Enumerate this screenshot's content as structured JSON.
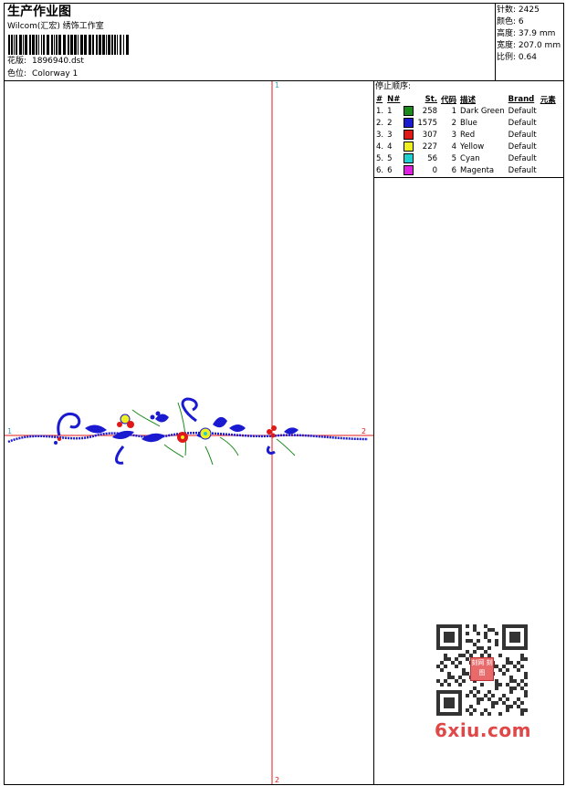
{
  "header": {
    "title": "生产作业图",
    "studio": "Wilcom(汇宏) 绣饰工作室",
    "design_file_label": "花版:",
    "design_file": "1896940.dst",
    "colorway_label": "色位:",
    "colorway": "Colorway 1"
  },
  "stats": {
    "stitches_label": "针数:",
    "stitches": "2425",
    "colors_label": "颜色:",
    "colors": "6",
    "height_label": "高度:",
    "height": "37.9 mm",
    "width_label": "宽度:",
    "width": "207.0 mm",
    "scale_label": "比例:",
    "scale": "0.64"
  },
  "stop_sequence": {
    "heading": "停止顺序:",
    "columns": [
      "#",
      "N#",
      "St.",
      "代码",
      "描述",
      "Brand",
      "元素"
    ],
    "rows": [
      {
        "idx": "1.",
        "n": "1",
        "color": "#1c8a1c",
        "st": "258",
        "code": "1",
        "desc": "Dark Green",
        "brand": "Default"
      },
      {
        "idx": "2.",
        "n": "2",
        "color": "#1a1ad0",
        "st": "1575",
        "code": "2",
        "desc": "Blue",
        "brand": "Default"
      },
      {
        "idx": "3.",
        "n": "3",
        "color": "#e01818",
        "st": "307",
        "code": "3",
        "desc": "Red",
        "brand": "Default"
      },
      {
        "idx": "4.",
        "n": "4",
        "color": "#f0f020",
        "st": "227",
        "code": "4",
        "desc": "Yellow",
        "brand": "Default"
      },
      {
        "idx": "5.",
        "n": "5",
        "color": "#20d0d0",
        "st": "56",
        "code": "5",
        "desc": "Cyan",
        "brand": "Default"
      },
      {
        "idx": "6.",
        "n": "6",
        "color": "#e020e0",
        "st": "0",
        "code": "6",
        "desc": "Magenta",
        "brand": "Default"
      }
    ]
  },
  "design_area": {
    "axis_labels": {
      "v_top": "1",
      "v_bottom": "2",
      "h_left": "1",
      "h_right": "2"
    },
    "axis_color": "#e01818"
  },
  "watermark": {
    "site": "6xiu.com",
    "seal_text": "刻网 刻图"
  }
}
